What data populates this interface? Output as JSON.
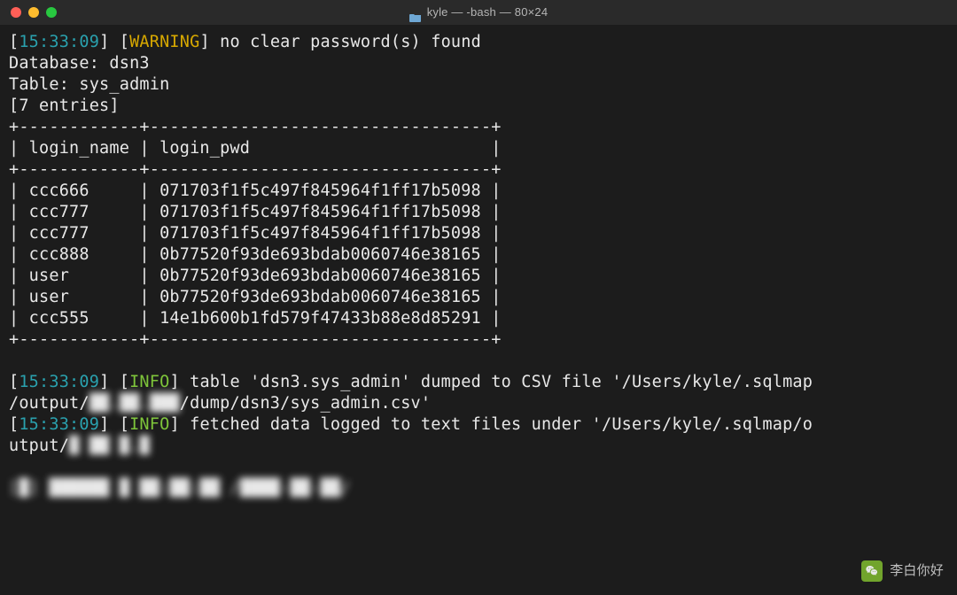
{
  "window": {
    "title": "kyle — -bash — 80×24"
  },
  "lines": {
    "warn_ts": "15:33:09",
    "warn_label": "WARNING",
    "warn_msg": "no clear password(s) found",
    "db_label": "Database:",
    "db_name": "dsn3",
    "table_label": "Table:",
    "table_name": "sys_admin",
    "entries": "[7 entries]",
    "border_top": "+------------+----------------------------------+",
    "hdr": "| login_name | login_pwd                        |",
    "border_mid": "+------------+----------------------------------+",
    "rows": [
      "| ccc666     | 071703f1f5c497f845964f1ff17b5098 |",
      "| ccc777     | 071703f1f5c497f845964f1ff17b5098 |",
      "| ccc777     | 071703f1f5c497f845964f1ff17b5098 |",
      "| ccc888     | 0b77520f93de693bdab0060746e38165 |",
      "| user       | 0b77520f93de693bdab0060746e38165 |",
      "| user       | 0b77520f93de693bdab0060746e38165 |",
      "| ccc555     | 14e1b600b1fd579f47433b88e8d85291 |"
    ],
    "border_bot": "+------------+----------------------------------+",
    "info1_ts": "15:33:09",
    "info_label": "INFO",
    "info1_a": "table '",
    "info1_tbl": "dsn3.sys_admin",
    "info1_b": "' dumped to CSV file '",
    "info1_path1": "/Users/kyle/.sqlmap",
    "info1_wrap": "/output/",
    "info1_red": "██.██.███",
    "info1_path2": "/dump/dsn3/sys_admin.csv'",
    "info2_ts": "15:33:09",
    "info2_a": "fetched data logged to text files under '",
    "info2_path": "/Users/kyle/.sqlmap/o",
    "info2_wrap": "utput/",
    "info2_red": "█ ██ █.█",
    "prompt_red": "[█] ██████ █ ██:██:██ /████-██-██/"
  },
  "watermark": {
    "text": "李白你好"
  },
  "chart_data": {
    "type": "table",
    "title": "dsn3.sys_admin",
    "columns": [
      "login_name",
      "login_pwd"
    ],
    "rows": [
      [
        "ccc666",
        "071703f1f5c497f845964f1ff17b5098"
      ],
      [
        "ccc777",
        "071703f1f5c497f845964f1ff17b5098"
      ],
      [
        "ccc777",
        "071703f1f5c497f845964f1ff17b5098"
      ],
      [
        "ccc888",
        "0b77520f93de693bdab0060746e38165"
      ],
      [
        "user",
        "0b77520f93de693bdab0060746e38165"
      ],
      [
        "user",
        "0b77520f93de693bdab0060746e38165"
      ],
      [
        "ccc555",
        "14e1b600b1fd579f47433b88e8d85291"
      ]
    ]
  }
}
